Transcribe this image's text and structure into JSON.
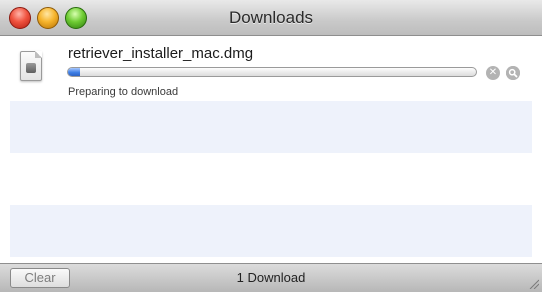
{
  "window": {
    "title": "Downloads"
  },
  "download": {
    "filename": "retriever_installer_mac.dmg",
    "status": "Preparing to download",
    "progress_fraction": 0.03,
    "icon": "disk-image-icon",
    "cancel_icon": "cancel-icon",
    "reveal_icon": "magnifier-icon"
  },
  "footer": {
    "clear_label": "Clear",
    "count_label": "1 Download"
  },
  "colors": {
    "stripe": "#eef2fb",
    "progress_accent": "#3e7fe6"
  }
}
